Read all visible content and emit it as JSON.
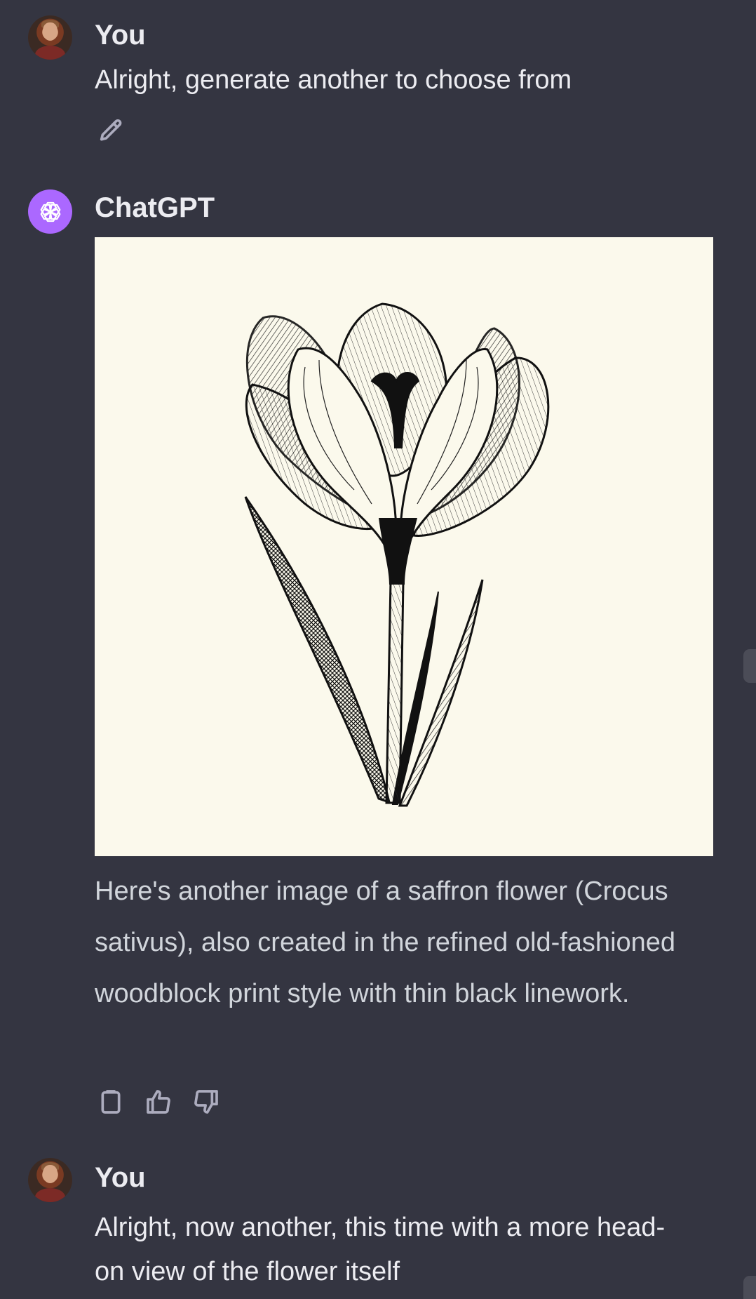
{
  "messages": [
    {
      "author": "You",
      "text": "Alright, generate another to choose from",
      "actions": [
        "edit-icon"
      ]
    },
    {
      "author": "ChatGPT",
      "image_alt": "",
      "text": "Here's another image of a saffron flower (Crocus sativus), also created in the refined old-fashioned woodblock print style with thin black linework.",
      "actions": [
        "copy-icon",
        "thumbs-up-icon",
        "thumbs-down-icon"
      ]
    },
    {
      "author": "You",
      "text": "Alright, now another, this time with a more head-on view of the flower itself"
    }
  ],
  "colors": {
    "background": "#343541",
    "text": "#ececf1",
    "reply_text": "#d1d5db",
    "icon": "#acacbe",
    "bot_avatar": "#ab68ff",
    "image_background": "#fbf9ec"
  }
}
